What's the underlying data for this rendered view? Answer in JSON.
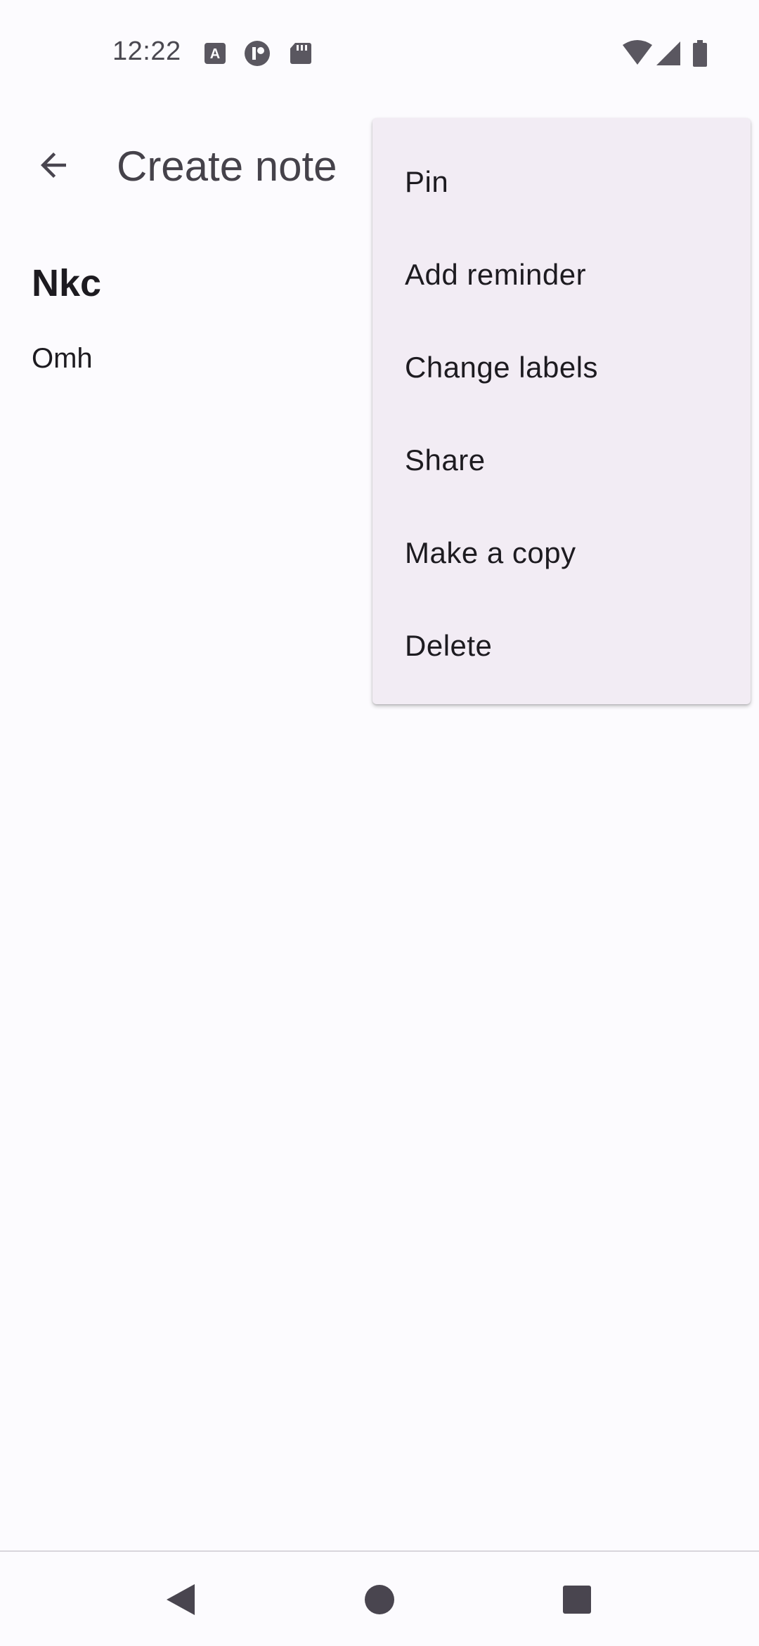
{
  "status_bar": {
    "time": "12:22",
    "icons": [
      "notification-a-icon",
      "notification-circle-icon",
      "sd-card-icon",
      "wifi-icon",
      "signal-icon",
      "battery-icon"
    ]
  },
  "app_bar": {
    "title": "Create note",
    "back_icon": "arrow-left-icon"
  },
  "note": {
    "title": "Nkc",
    "body": "Omh"
  },
  "menu": {
    "items": [
      {
        "label": "Pin"
      },
      {
        "label": "Add reminder"
      },
      {
        "label": "Change labels"
      },
      {
        "label": "Share"
      },
      {
        "label": "Make a copy"
      },
      {
        "label": "Delete"
      }
    ]
  },
  "nav_bar": {
    "icons": [
      "back-triangle-icon",
      "home-circle-icon",
      "recents-square-icon"
    ]
  },
  "colors": {
    "background": "#fcfbfe",
    "menu_background": "#f2ecf4",
    "text_primary": "#1d1b20",
    "icon": "#49454f"
  }
}
